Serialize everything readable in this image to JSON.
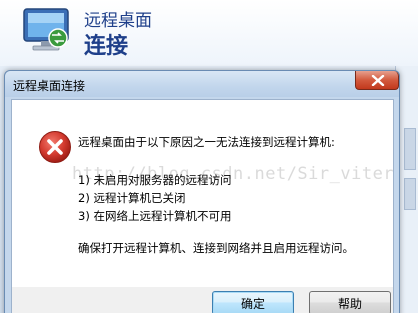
{
  "app": {
    "subtitle": "远程桌面",
    "title": "连接"
  },
  "dialog": {
    "title": "远程桌面连接",
    "message": "远程桌面由于以下原因之一无法连接到远程计算机:",
    "reasons": [
      "1) 未启用对服务器的远程访问",
      "2) 远程计算机已关闭",
      "3) 在网络上远程计算机不可用"
    ],
    "advice": "确保打开远程计算机、连接到网络并且启用远程访问。",
    "watermark": "http://blog.csdn.net/Sir_viter",
    "buttons": {
      "ok": "确定",
      "help": "帮助"
    },
    "icons": {
      "error": "error-icon",
      "close": "close-icon",
      "app": "remote-desktop-monitor-icon"
    }
  },
  "colors": {
    "title_text": "#1e3f8a",
    "error_red": "#c8302a",
    "close_red": "#c2381c"
  }
}
